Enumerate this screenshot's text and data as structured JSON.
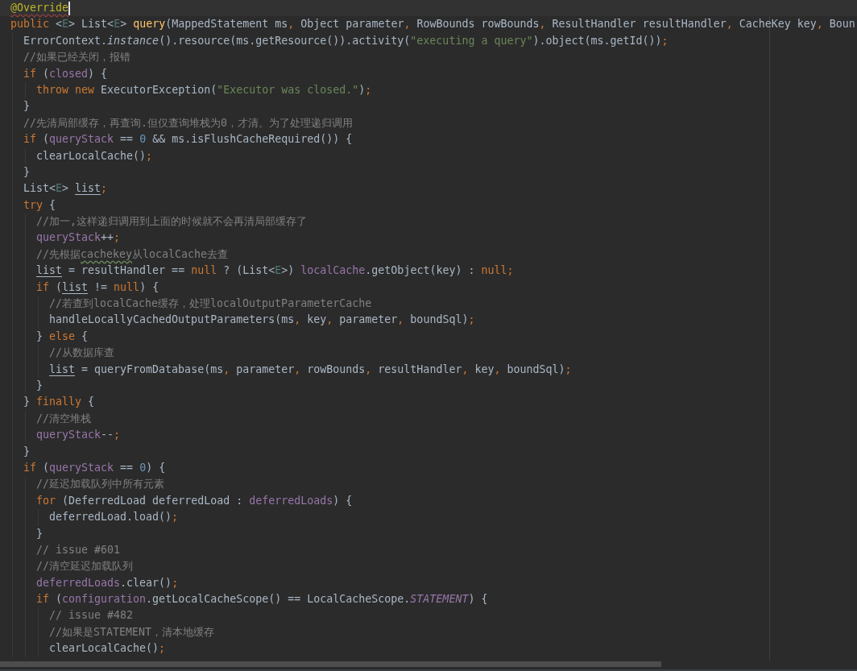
{
  "editor": {
    "lines": [
      {
        "current": true,
        "tokens": [
          {
            "kind": "annotation_flagged",
            "text": "@Override"
          }
        ]
      },
      {
        "current": false,
        "tokens": [
          {
            "kind": "keyword",
            "text": "public"
          },
          {
            "kind": "plain",
            "text": " <"
          },
          {
            "kind": "type_param",
            "text": "E"
          },
          {
            "kind": "plain",
            "text": "> List<"
          },
          {
            "kind": "type_param",
            "text": "E"
          },
          {
            "kind": "plain",
            "text": "> "
          },
          {
            "kind": "method_decl",
            "text": "query"
          },
          {
            "kind": "plain",
            "text": "(MappedStatement ms"
          },
          {
            "kind": "keyword",
            "text": ","
          },
          {
            "kind": "plain",
            "text": " Object parameter"
          },
          {
            "kind": "keyword",
            "text": ","
          },
          {
            "kind": "plain",
            "text": " RowBounds rowBounds"
          },
          {
            "kind": "keyword",
            "text": ","
          },
          {
            "kind": "plain",
            "text": " ResultHandler resultHandler"
          },
          {
            "kind": "keyword",
            "text": ","
          },
          {
            "kind": "plain",
            "text": " CacheKey key"
          },
          {
            "kind": "keyword",
            "text": ","
          },
          {
            "kind": "plain",
            "text": " Boun"
          }
        ],
        "children": [
          {
            "current": false,
            "tokens": [
              {
                "kind": "plain",
                "text": "ErrorContext."
              },
              {
                "kind": "static",
                "text": "instance"
              },
              {
                "kind": "plain",
                "text": "().resource(ms.getResource()).activity("
              },
              {
                "kind": "string",
                "text": "\"executing a query\""
              },
              {
                "kind": "plain",
                "text": ").object(ms.getId())"
              },
              {
                "kind": "keyword",
                "text": ";"
              }
            ]
          },
          {
            "current": false,
            "tokens": [
              {
                "kind": "comment",
                "text": "//如果已经关闭，报错"
              }
            ]
          },
          {
            "current": false,
            "tokens": [
              {
                "kind": "keyword",
                "text": "if"
              },
              {
                "kind": "plain",
                "text": " ("
              },
              {
                "kind": "field",
                "text": "closed"
              },
              {
                "kind": "plain",
                "text": ") {"
              }
            ],
            "children": [
              {
                "current": false,
                "tokens": [
                  {
                    "kind": "keyword",
                    "text": "throw new"
                  },
                  {
                    "kind": "plain",
                    "text": " ExecutorException("
                  },
                  {
                    "kind": "string",
                    "text": "\"Executor was closed.\""
                  },
                  {
                    "kind": "plain",
                    "text": ")"
                  },
                  {
                    "kind": "keyword",
                    "text": ";"
                  }
                ]
              }
            ]
          },
          {
            "current": false,
            "tokens": [
              {
                "kind": "plain",
                "text": "}"
              }
            ]
          },
          {
            "current": false,
            "tokens": [
              {
                "kind": "comment",
                "text": "//先清局部缓存，再查询.但仅查询堆栈为0，才清。为了处理递归调用"
              }
            ]
          },
          {
            "current": false,
            "tokens": [
              {
                "kind": "keyword",
                "text": "if"
              },
              {
                "kind": "plain",
                "text": " ("
              },
              {
                "kind": "field",
                "text": "queryStack"
              },
              {
                "kind": "plain",
                "text": " == "
              },
              {
                "kind": "number",
                "text": "0"
              },
              {
                "kind": "plain",
                "text": " && ms.isFlushCacheRequired()) {"
              }
            ],
            "children": [
              {
                "current": false,
                "tokens": [
                  {
                    "kind": "plain",
                    "text": "clearLocalCache()"
                  },
                  {
                    "kind": "keyword",
                    "text": ";"
                  }
                ]
              }
            ]
          },
          {
            "current": false,
            "tokens": [
              {
                "kind": "plain",
                "text": "}"
              }
            ]
          },
          {
            "current": false,
            "tokens": [
              {
                "kind": "plain",
                "text": "List<"
              },
              {
                "kind": "type_param",
                "text": "E"
              },
              {
                "kind": "plain",
                "text": "> "
              },
              {
                "kind": "reassigned",
                "text": "list"
              },
              {
                "kind": "keyword",
                "text": ";"
              }
            ]
          },
          {
            "current": false,
            "tokens": [
              {
                "kind": "keyword",
                "text": "try"
              },
              {
                "kind": "plain",
                "text": " {"
              }
            ],
            "children": [
              {
                "current": false,
                "tokens": [
                  {
                    "kind": "comment",
                    "text": "//加一,这样递归调用到上面的时候就不会再清局部缓存了"
                  }
                ]
              },
              {
                "current": false,
                "tokens": [
                  {
                    "kind": "field",
                    "text": "queryStack"
                  },
                  {
                    "kind": "plain",
                    "text": "++"
                  },
                  {
                    "kind": "keyword",
                    "text": ";"
                  }
                ]
              },
              {
                "current": false,
                "tokens": [
                  {
                    "kind": "comment",
                    "text": "//先根据"
                  },
                  {
                    "kind": "comment_typo",
                    "text": "cachekey"
                  },
                  {
                    "kind": "comment",
                    "text": "从localCache去查"
                  }
                ]
              },
              {
                "current": false,
                "tokens": [
                  {
                    "kind": "reassigned",
                    "text": "list"
                  },
                  {
                    "kind": "plain",
                    "text": " = resultHandler == "
                  },
                  {
                    "kind": "keyword",
                    "text": "null"
                  },
                  {
                    "kind": "plain",
                    "text": " ? (List<"
                  },
                  {
                    "kind": "type_param",
                    "text": "E"
                  },
                  {
                    "kind": "plain",
                    "text": ">) "
                  },
                  {
                    "kind": "field",
                    "text": "localCache"
                  },
                  {
                    "kind": "plain",
                    "text": ".getObject(key) : "
                  },
                  {
                    "kind": "keyword",
                    "text": "null;"
                  }
                ]
              },
              {
                "current": false,
                "tokens": [
                  {
                    "kind": "keyword",
                    "text": "if"
                  },
                  {
                    "kind": "plain",
                    "text": " ("
                  },
                  {
                    "kind": "reassigned",
                    "text": "list"
                  },
                  {
                    "kind": "plain",
                    "text": " != "
                  },
                  {
                    "kind": "keyword",
                    "text": "null"
                  },
                  {
                    "kind": "plain",
                    "text": ") {"
                  }
                ],
                "children": [
                  {
                    "current": false,
                    "tokens": [
                      {
                        "kind": "comment",
                        "text": "//若查到localCache缓存，处理localOutputParameterCache"
                      }
                    ]
                  },
                  {
                    "current": false,
                    "tokens": [
                      {
                        "kind": "plain",
                        "text": "handleLocallyCachedOutputParameters(ms"
                      },
                      {
                        "kind": "keyword",
                        "text": ","
                      },
                      {
                        "kind": "plain",
                        "text": " key"
                      },
                      {
                        "kind": "keyword",
                        "text": ","
                      },
                      {
                        "kind": "plain",
                        "text": " parameter"
                      },
                      {
                        "kind": "keyword",
                        "text": ","
                      },
                      {
                        "kind": "plain",
                        "text": " boundSql)"
                      },
                      {
                        "kind": "keyword",
                        "text": ";"
                      }
                    ]
                  }
                ]
              },
              {
                "current": false,
                "tokens": [
                  {
                    "kind": "plain",
                    "text": "} "
                  },
                  {
                    "kind": "keyword",
                    "text": "else"
                  },
                  {
                    "kind": "plain",
                    "text": " {"
                  }
                ],
                "children": [
                  {
                    "current": false,
                    "tokens": [
                      {
                        "kind": "comment",
                        "text": "//从数据库查"
                      }
                    ]
                  },
                  {
                    "current": false,
                    "tokens": [
                      {
                        "kind": "reassigned",
                        "text": "list"
                      },
                      {
                        "kind": "plain",
                        "text": " = queryFromDatabase(ms"
                      },
                      {
                        "kind": "keyword",
                        "text": ","
                      },
                      {
                        "kind": "plain",
                        "text": " parameter"
                      },
                      {
                        "kind": "keyword",
                        "text": ","
                      },
                      {
                        "kind": "plain",
                        "text": " rowBounds"
                      },
                      {
                        "kind": "keyword",
                        "text": ","
                      },
                      {
                        "kind": "plain",
                        "text": " resultHandler"
                      },
                      {
                        "kind": "keyword",
                        "text": ","
                      },
                      {
                        "kind": "plain",
                        "text": " key"
                      },
                      {
                        "kind": "keyword",
                        "text": ","
                      },
                      {
                        "kind": "plain",
                        "text": " boundSql)"
                      },
                      {
                        "kind": "keyword",
                        "text": ";"
                      }
                    ]
                  }
                ]
              },
              {
                "current": false,
                "tokens": [
                  {
                    "kind": "plain",
                    "text": "}"
                  }
                ]
              }
            ]
          },
          {
            "current": false,
            "tokens": [
              {
                "kind": "plain",
                "text": "} "
              },
              {
                "kind": "keyword",
                "text": "finally"
              },
              {
                "kind": "plain",
                "text": " {"
              }
            ],
            "children": [
              {
                "current": false,
                "tokens": [
                  {
                    "kind": "comment",
                    "text": "//清空堆栈"
                  }
                ]
              },
              {
                "current": false,
                "tokens": [
                  {
                    "kind": "field",
                    "text": "queryStack"
                  },
                  {
                    "kind": "plain",
                    "text": "--"
                  },
                  {
                    "kind": "keyword",
                    "text": ";"
                  }
                ]
              }
            ]
          },
          {
            "current": false,
            "tokens": [
              {
                "kind": "plain",
                "text": "}"
              }
            ]
          },
          {
            "current": false,
            "tokens": [
              {
                "kind": "keyword",
                "text": "if"
              },
              {
                "kind": "plain",
                "text": " ("
              },
              {
                "kind": "field",
                "text": "queryStack"
              },
              {
                "kind": "plain",
                "text": " == "
              },
              {
                "kind": "number",
                "text": "0"
              },
              {
                "kind": "plain",
                "text": ") {"
              }
            ],
            "children": [
              {
                "current": false,
                "tokens": [
                  {
                    "kind": "comment",
                    "text": "//延迟加载队列中所有元素"
                  }
                ]
              },
              {
                "current": false,
                "tokens": [
                  {
                    "kind": "keyword",
                    "text": "for"
                  },
                  {
                    "kind": "plain",
                    "text": " (DeferredLoad deferredLoad : "
                  },
                  {
                    "kind": "field",
                    "text": "deferredLoads"
                  },
                  {
                    "kind": "plain",
                    "text": ") {"
                  }
                ],
                "children": [
                  {
                    "current": false,
                    "tokens": [
                      {
                        "kind": "plain",
                        "text": "deferredLoad.load()"
                      },
                      {
                        "kind": "keyword",
                        "text": ";"
                      }
                    ]
                  }
                ]
              },
              {
                "current": false,
                "tokens": [
                  {
                    "kind": "plain",
                    "text": "}"
                  }
                ]
              },
              {
                "current": false,
                "tokens": [
                  {
                    "kind": "comment",
                    "text": "// issue #601"
                  }
                ]
              },
              {
                "current": false,
                "tokens": [
                  {
                    "kind": "comment",
                    "text": "//清空延迟加载队列"
                  }
                ]
              },
              {
                "current": false,
                "tokens": [
                  {
                    "kind": "field",
                    "text": "deferredLoads"
                  },
                  {
                    "kind": "plain",
                    "text": ".clear()"
                  },
                  {
                    "kind": "keyword",
                    "text": ";"
                  }
                ]
              },
              {
                "current": false,
                "tokens": [
                  {
                    "kind": "keyword",
                    "text": "if"
                  },
                  {
                    "kind": "plain",
                    "text": " ("
                  },
                  {
                    "kind": "field",
                    "text": "configuration"
                  },
                  {
                    "kind": "plain",
                    "text": ".getLocalCacheScope() == LocalCacheScope."
                  },
                  {
                    "kind": "constant",
                    "text": "STATEMENT"
                  },
                  {
                    "kind": "plain",
                    "text": ") {"
                  }
                ],
                "children": [
                  {
                    "current": false,
                    "tokens": [
                      {
                        "kind": "comment",
                        "text": "// issue #482"
                      }
                    ]
                  },
                  {
                    "current": false,
                    "tokens": [
                      {
                        "kind": "comment",
                        "text": "//如果是STATEMENT，清本地缓存"
                      }
                    ]
                  },
                  {
                    "current": false,
                    "tokens": [
                      {
                        "kind": "plain",
                        "text": "clearLocalCache()"
                      },
                      {
                        "kind": "keyword",
                        "text": ";"
                      }
                    ]
                  }
                ]
              }
            ]
          }
        ]
      }
    ]
  }
}
